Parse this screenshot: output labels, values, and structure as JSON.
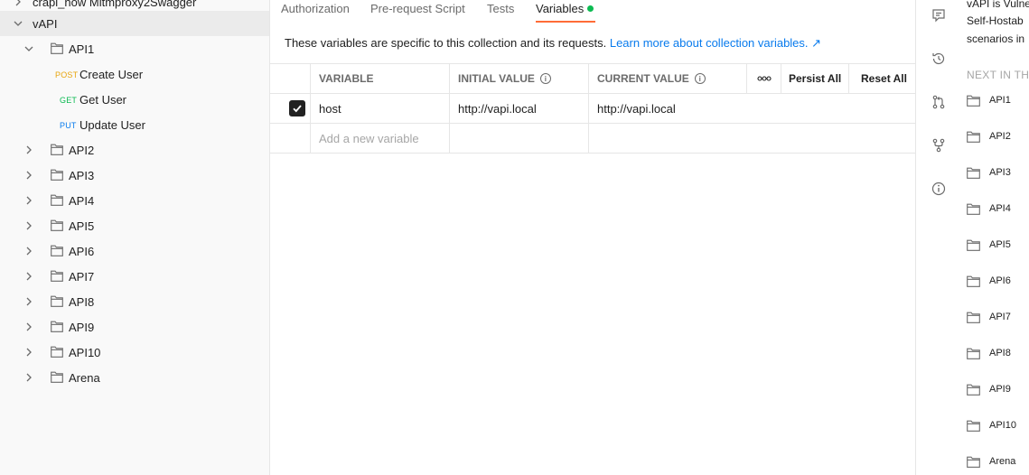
{
  "sidebar": {
    "top_partial_item": "crapi_now Mitmproxy2Swagger",
    "collection_name": "vAPI",
    "folder_api1": "API1",
    "requests": [
      {
        "method": "POST",
        "name": "Create User"
      },
      {
        "method": "GET",
        "name": "Get User"
      },
      {
        "method": "PUT",
        "name": "Update User"
      }
    ],
    "folders": [
      "API2",
      "API3",
      "API4",
      "API5",
      "API6",
      "API7",
      "API8",
      "API9",
      "API10",
      "Arena"
    ]
  },
  "tabs": {
    "authorization": "Authorization",
    "prerequest": "Pre-request Script",
    "tests": "Tests",
    "variables": "Variables"
  },
  "info": {
    "text": "These variables are specific to this collection and its requests. ",
    "link": "Learn more about collection variables. ↗"
  },
  "table": {
    "col_variable": "VARIABLE",
    "col_initial": "INITIAL VALUE",
    "col_current": "CURRENT VALUE",
    "more_label": "ooo",
    "persist_all": "Persist All",
    "reset_all": "Reset All",
    "rows": [
      {
        "checked": true,
        "variable": "host",
        "initial": "http://vapi.local",
        "current": "http://vapi.local"
      }
    ],
    "add_placeholder": "Add a new variable"
  },
  "right_panel": {
    "desc_line1": "vAPI is Vulne",
    "desc_line2": "Self-Hostab",
    "desc_line3": "scenarios in",
    "next_header": "NEXT IN THI",
    "items": [
      "API1",
      "API2",
      "API3",
      "API4",
      "API5",
      "API6",
      "API7",
      "API8",
      "API9",
      "API10",
      "Arena"
    ]
  },
  "colors": {
    "accent": "#ff6c37",
    "link": "#097bed",
    "post": "#e8a60f",
    "get": "#0cbb52",
    "put": "#097bed"
  }
}
